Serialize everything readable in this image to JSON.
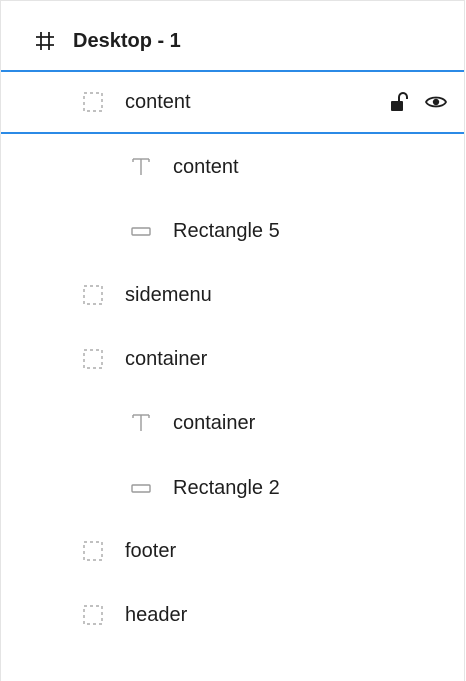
{
  "layers": [
    {
      "label": "Desktop - 1",
      "type": "frame",
      "icon": "hash-frame-icon"
    },
    {
      "label": "content",
      "type": "group",
      "icon": "dashed-group-icon"
    },
    {
      "label": "content",
      "type": "text",
      "icon": "text-t-icon"
    },
    {
      "label": "Rectangle 5",
      "type": "rectangle",
      "icon": "rectangle-icon"
    },
    {
      "label": "sidemenu",
      "type": "group",
      "icon": "dashed-group-icon"
    },
    {
      "label": "container",
      "type": "group",
      "icon": "dashed-group-icon"
    },
    {
      "label": "container",
      "type": "text",
      "icon": "text-t-icon"
    },
    {
      "label": "Rectangle 2",
      "type": "rectangle",
      "icon": "rectangle-icon"
    },
    {
      "label": "footer",
      "type": "group",
      "icon": "dashed-group-icon"
    },
    {
      "label": "header",
      "type": "group",
      "icon": "dashed-group-icon"
    }
  ],
  "selected_layer": "content",
  "row_actions": {
    "lock_icon": "unlock-icon",
    "visibility_icon": "eye-icon"
  },
  "colors": {
    "selection_border": "#2b8ae6",
    "text": "#1e1e1e",
    "icon_muted": "#9a9a9a"
  }
}
